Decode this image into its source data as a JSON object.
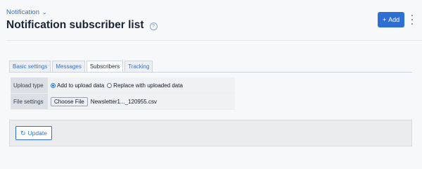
{
  "breadcrumb": {
    "label": "Notification",
    "chevron": "chevron-down-icon"
  },
  "page": {
    "title": "Notification subscriber list",
    "help_icon": "question-icon"
  },
  "header_actions": {
    "add_label": "Add",
    "add_icon": "plus-icon",
    "more_icon": "vertical-dots-icon"
  },
  "tabs": [
    {
      "label": "Basic settings",
      "active": false
    },
    {
      "label": "Messages",
      "active": false
    },
    {
      "label": "Subscribers",
      "active": true
    },
    {
      "label": "Tracking",
      "active": false
    }
  ],
  "settings": {
    "upload_type": {
      "label": "Upload type",
      "options": [
        {
          "label": "Add to upload data",
          "checked": true
        },
        {
          "label": "Replace with uploaded data",
          "checked": false
        }
      ]
    },
    "file_settings": {
      "label": "File settings",
      "choose_label": "Choose File",
      "file_name": "Newsletter1..._120955.csv"
    }
  },
  "actions": {
    "update_label": "Update",
    "update_icon": "refresh-icon"
  },
  "colors": {
    "accent": "#2d6fd2",
    "background": "#f7f8fa"
  }
}
